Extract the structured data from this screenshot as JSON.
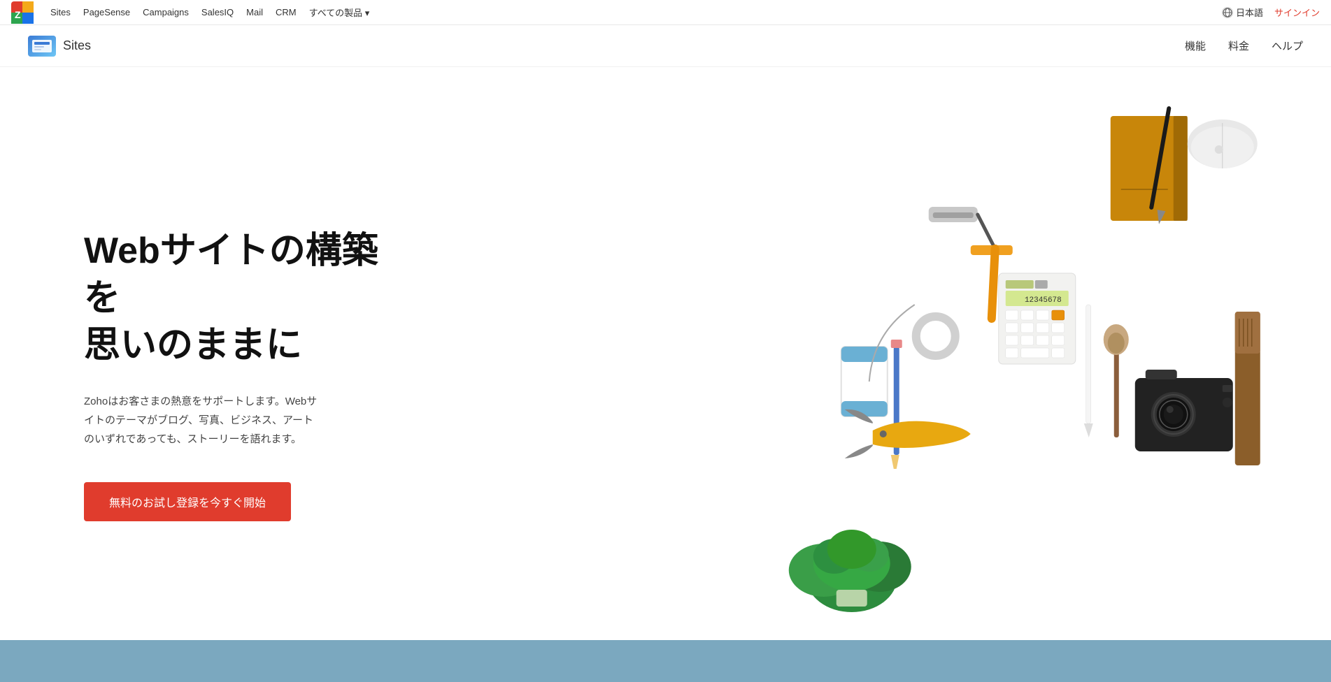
{
  "top_nav": {
    "logo_text": "ZOHO",
    "links": [
      {
        "label": "Sites",
        "id": "sites"
      },
      {
        "label": "PageSense",
        "id": "pagesense"
      },
      {
        "label": "Campaigns",
        "id": "campaigns"
      },
      {
        "label": "SalesIQ",
        "id": "salesiq"
      },
      {
        "label": "Mail",
        "id": "mail"
      },
      {
        "label": "CRM",
        "id": "crm"
      },
      {
        "label": "すべての製品 ▾",
        "id": "all-products"
      }
    ],
    "language_label": "日本語",
    "signin_label": "サインイン"
  },
  "secondary_nav": {
    "sites_label": "Sites",
    "links": [
      {
        "label": "機能",
        "id": "features"
      },
      {
        "label": "料金",
        "id": "pricing"
      },
      {
        "label": "ヘルプ",
        "id": "help"
      }
    ]
  },
  "hero": {
    "title": "Webサイトの構築\nを\n思いのままに",
    "title_line1": "Webサイトの構築",
    "title_line2": "を",
    "title_line3": "思いのままに",
    "description": "Zohoはお客さまの熱意をサポートします。Webサイトのテーマがブログ、写真、ビジネス、アートのいずれであっても、ストーリーを語れます。",
    "cta_label": "無料のお試し登録を今すぐ開始",
    "calc_display": "12345678"
  },
  "colors": {
    "primary_red": "#e03c2d",
    "nav_bg": "#ffffff",
    "bottom_strip": "#7ba8bf",
    "text_dark": "#111111",
    "text_medium": "#444444"
  }
}
